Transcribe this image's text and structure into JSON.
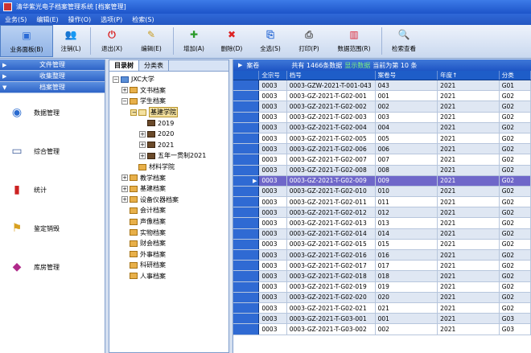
{
  "window": {
    "title": "清华紫光电子档案管理系统 [档案管理]"
  },
  "menu": [
    "业务(S)",
    "编辑(E)",
    "操作(O)",
    "选项(P)",
    "检索(S)"
  ],
  "toolbar": [
    {
      "label": "业务面板(B)",
      "icon": "dashboard-icon",
      "color": "#2b6bd6",
      "glyph": "▣"
    },
    {
      "label": "注销(L)",
      "icon": "users-icon",
      "color": "#c27a1a",
      "glyph": "👥"
    },
    {
      "label": "退出(X)",
      "icon": "power-icon",
      "color": "#d92020",
      "glyph": "⏻"
    },
    {
      "label": "编辑(E)",
      "icon": "edit-icon",
      "color": "#c89b1e",
      "glyph": "✎"
    },
    {
      "label": "增加(A)",
      "icon": "plus-icon",
      "color": "#2a9a2a",
      "glyph": "✚"
    },
    {
      "label": "删除(D)",
      "icon": "delete-icon",
      "color": "#d22",
      "glyph": "✖"
    },
    {
      "label": "全选(S)",
      "icon": "select-all-icon",
      "color": "#2b6bd6",
      "glyph": "⎘"
    },
    {
      "label": "打印(P)",
      "icon": "print-icon",
      "color": "#555",
      "glyph": "⎙"
    },
    {
      "label": "数据范围(R)",
      "icon": "range-icon",
      "color": "#d23",
      "glyph": "▥"
    },
    {
      "label": "检索查看",
      "icon": "search-icon",
      "color": "#225",
      "glyph": "🔍"
    }
  ],
  "left_panel": {
    "sections": [
      "文件管理",
      "收集整理",
      "档案管理"
    ],
    "items": [
      {
        "label": "数据管理",
        "icon": "data-icon",
        "glyph": "◉",
        "color": "#2a6bd0"
      },
      {
        "label": "综合管理",
        "icon": "monitor-icon",
        "glyph": "▭",
        "color": "#3a5a9a"
      },
      {
        "label": "统计",
        "icon": "chart-icon",
        "glyph": "▮",
        "color": "#c22"
      },
      {
        "label": "鉴定销毁",
        "icon": "stamp-icon",
        "glyph": "⚑",
        "color": "#d8a020"
      },
      {
        "label": "库房管理",
        "icon": "book-icon",
        "glyph": "◆",
        "color": "#b02a8a"
      }
    ]
  },
  "tree": {
    "tabs": [
      "目录树",
      "分类表"
    ],
    "nodes": [
      {
        "label": "JXC大学",
        "level": 0,
        "exp": "−",
        "kind": "root"
      },
      {
        "label": "文书档案",
        "level": 1,
        "exp": "+",
        "kind": "folder"
      },
      {
        "label": "学生档案",
        "level": 1,
        "exp": "−",
        "kind": "folder"
      },
      {
        "label": "基建学院",
        "level": 2,
        "exp": "−",
        "kind": "folder",
        "selected": true
      },
      {
        "label": "2019",
        "level": 3,
        "exp": "",
        "kind": "dark"
      },
      {
        "label": "2020",
        "level": 3,
        "exp": "+",
        "kind": "dark"
      },
      {
        "label": "2021",
        "level": 3,
        "exp": "+",
        "kind": "dark"
      },
      {
        "label": "五年一贯制2021",
        "level": 3,
        "exp": "+",
        "kind": "dark"
      },
      {
        "label": "材料学院",
        "level": 2,
        "exp": "",
        "kind": "folder"
      },
      {
        "label": "教学档案",
        "level": 1,
        "exp": "+",
        "kind": "folder"
      },
      {
        "label": "基建档案",
        "level": 1,
        "exp": "+",
        "kind": "folder"
      },
      {
        "label": "设备仪器档案",
        "level": 1,
        "exp": "+",
        "kind": "folder"
      },
      {
        "label": "会计档案",
        "level": 1,
        "exp": "",
        "kind": "folder"
      },
      {
        "label": "声像档案",
        "level": 1,
        "exp": "",
        "kind": "folder"
      },
      {
        "label": "实物档案",
        "level": 1,
        "exp": "",
        "kind": "folder"
      },
      {
        "label": "财会档案",
        "level": 1,
        "exp": "",
        "kind": "folder"
      },
      {
        "label": "外事档案",
        "level": 1,
        "exp": "",
        "kind": "folder"
      },
      {
        "label": "科研档案",
        "level": 1,
        "exp": "",
        "kind": "folder"
      },
      {
        "label": "人事档案",
        "level": 1,
        "exp": "",
        "kind": "folder"
      }
    ]
  },
  "grid": {
    "top": {
      "title": "案卷",
      "summary": "共有 1466条数据",
      "highlight": "显示数据",
      "page": "当前为第 10 条"
    },
    "columns": [
      "全宗号",
      "档号",
      "案卷号",
      "年度↑",
      "分类"
    ],
    "selected_index": 9,
    "rows": [
      [
        "0003",
        "0003-GZW-2021-T-001-043",
        "043",
        "2021",
        "G01"
      ],
      [
        "0003",
        "0003-GZ-2021-T-G02-001",
        "001",
        "2021",
        "G02"
      ],
      [
        "0003",
        "0003-GZ-2021-T-G02-002",
        "002",
        "2021",
        "G02"
      ],
      [
        "0003",
        "0003-GZ-2021-T-G02-003",
        "003",
        "2021",
        "G02"
      ],
      [
        "0003",
        "0003-GZ-2021-T-G02-004",
        "004",
        "2021",
        "G02"
      ],
      [
        "0003",
        "0003-GZ-2021-T-G02-005",
        "005",
        "2021",
        "G02"
      ],
      [
        "0003",
        "0003-GZ-2021-T-G02-006",
        "006",
        "2021",
        "G02"
      ],
      [
        "0003",
        "0003-GZ-2021-T-G02-007",
        "007",
        "2021",
        "G02"
      ],
      [
        "0003",
        "0003-GZ-2021-T-G02-008",
        "008",
        "2021",
        "G02"
      ],
      [
        "0003",
        "0003-GZ-2021-T-G02-009",
        "009",
        "2021",
        "G02"
      ],
      [
        "0003",
        "0003-GZ-2021-T-G02-010",
        "010",
        "2021",
        "G02"
      ],
      [
        "0003",
        "0003-GZ-2021-T-G02-011",
        "011",
        "2021",
        "G02"
      ],
      [
        "0003",
        "0003-GZ-2021-T-G02-012",
        "012",
        "2021",
        "G02"
      ],
      [
        "0003",
        "0003-GZ-2021-T-G02-013",
        "013",
        "2021",
        "G02"
      ],
      [
        "0003",
        "0003-GZ-2021-T-G02-014",
        "014",
        "2021",
        "G02"
      ],
      [
        "0003",
        "0003-GZ-2021-T-G02-015",
        "015",
        "2021",
        "G02"
      ],
      [
        "0003",
        "0003-GZ-2021-T-G02-016",
        "016",
        "2021",
        "G02"
      ],
      [
        "0003",
        "0003-GZ-2021-T-G02-017",
        "017",
        "2021",
        "G02"
      ],
      [
        "0003",
        "0003-GZ-2021-T-G02-018",
        "018",
        "2021",
        "G02"
      ],
      [
        "0003",
        "0003-GZ-2021-T-G02-019",
        "019",
        "2021",
        "G02"
      ],
      [
        "0003",
        "0003-GZ-2021-T-G02-020",
        "020",
        "2021",
        "G02"
      ],
      [
        "0003",
        "0003-GZ-2021-T-G02-021",
        "021",
        "2021",
        "G02"
      ],
      [
        "0003",
        "0003-GZ-2021-T-G03-001",
        "001",
        "2021",
        "G03"
      ],
      [
        "0003",
        "0003-GZ-2021-T-G03-002",
        "002",
        "2021",
        "G03"
      ]
    ]
  }
}
